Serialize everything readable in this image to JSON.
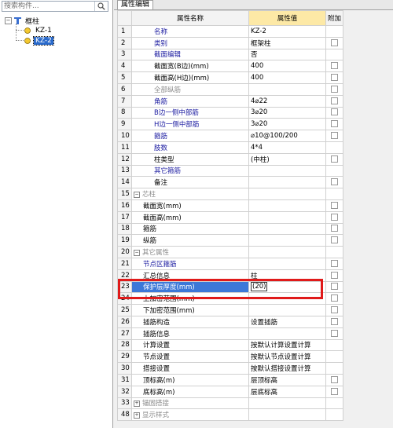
{
  "search": {
    "placeholder": "搜索构件..."
  },
  "tree": {
    "root": "框柱",
    "children": [
      "KZ-1",
      "KZ-2"
    ]
  },
  "tab": {
    "label": "属性编辑"
  },
  "grid": {
    "headers": {
      "name": "属性名称",
      "value": "属性值",
      "extra": "附加"
    },
    "rows": [
      {
        "n": "1",
        "name": "名称",
        "value": "KZ-2",
        "style": "blue",
        "check": false
      },
      {
        "n": "2",
        "name": "类别",
        "value": "框架柱",
        "style": "blue",
        "check": true
      },
      {
        "n": "3",
        "name": "截面编辑",
        "value": "否",
        "style": "blue",
        "check": false
      },
      {
        "n": "4",
        "name": "截面宽(B边)(mm)",
        "value": "400",
        "style": "",
        "check": true
      },
      {
        "n": "5",
        "name": "截面高(H边)(mm)",
        "value": "400",
        "style": "",
        "check": true
      },
      {
        "n": "6",
        "name": "全部纵筋",
        "value": "",
        "style": "gray",
        "check": true
      },
      {
        "n": "7",
        "name": "角筋",
        "value": "4⌀22",
        "style": "blue",
        "check": true
      },
      {
        "n": "8",
        "name": "B边一侧中部筋",
        "value": "3⌀20",
        "style": "blue",
        "check": true
      },
      {
        "n": "9",
        "name": "H边一侧中部筋",
        "value": "3⌀20",
        "style": "blue",
        "check": true
      },
      {
        "n": "10",
        "name": "箍筋",
        "value": "⌀10@100/200",
        "style": "blue",
        "check": true
      },
      {
        "n": "11",
        "name": "肢数",
        "value": "4*4",
        "style": "blue",
        "check": false
      },
      {
        "n": "12",
        "name": "柱类型",
        "value": "(中柱)",
        "style": "",
        "check": true
      },
      {
        "n": "13",
        "name": "其它箍筋",
        "value": "",
        "style": "blue",
        "check": false
      },
      {
        "n": "14",
        "name": "备注",
        "value": "",
        "style": "",
        "check": true
      },
      {
        "n": "15",
        "name": "芯柱",
        "value": "",
        "style": "group",
        "check": false
      },
      {
        "n": "16",
        "name": "截面宽(mm)",
        "value": "",
        "style": "child",
        "check": true
      },
      {
        "n": "17",
        "name": "截面高(mm)",
        "value": "",
        "style": "child",
        "check": true
      },
      {
        "n": "18",
        "name": "箍筋",
        "value": "",
        "style": "child",
        "check": true
      },
      {
        "n": "19",
        "name": "纵筋",
        "value": "",
        "style": "child",
        "check": true
      },
      {
        "n": "20",
        "name": "其它属性",
        "value": "",
        "style": "group",
        "check": false
      },
      {
        "n": "21",
        "name": "节点区箍筋",
        "value": "",
        "style": "childblue",
        "check": true
      },
      {
        "n": "22",
        "name": "汇总信息",
        "value": "柱",
        "style": "child",
        "check": true
      },
      {
        "n": "23",
        "name": "保护层厚度(mm)",
        "value": "(20)",
        "style": "selected",
        "check": true
      },
      {
        "n": "24",
        "name": "上加密范围(mm)",
        "value": "",
        "style": "child",
        "check": true
      },
      {
        "n": "25",
        "name": "下加密范围(mm)",
        "value": "",
        "style": "child",
        "check": true
      },
      {
        "n": "26",
        "name": "插筋构造",
        "value": "设置插筋",
        "style": "child",
        "check": true
      },
      {
        "n": "27",
        "name": "插筋信息",
        "value": "",
        "style": "child",
        "check": true
      },
      {
        "n": "28",
        "name": "计算设置",
        "value": "按默认计算设置计算",
        "style": "child",
        "check": false
      },
      {
        "n": "29",
        "name": "节点设置",
        "value": "按默认节点设置计算",
        "style": "child",
        "check": false
      },
      {
        "n": "30",
        "name": "搭接设置",
        "value": "按默认搭接设置计算",
        "style": "child",
        "check": false
      },
      {
        "n": "31",
        "name": "顶标高(m)",
        "value": "层顶标高",
        "style": "child",
        "check": true
      },
      {
        "n": "32",
        "name": "底标高(m)",
        "value": "层底标高",
        "style": "child",
        "check": true
      },
      {
        "n": "33",
        "name": "锚固搭接",
        "value": "",
        "style": "groupc",
        "check": false
      },
      {
        "n": "48",
        "name": "显示样式",
        "value": "",
        "style": "groupc",
        "check": false
      }
    ]
  }
}
